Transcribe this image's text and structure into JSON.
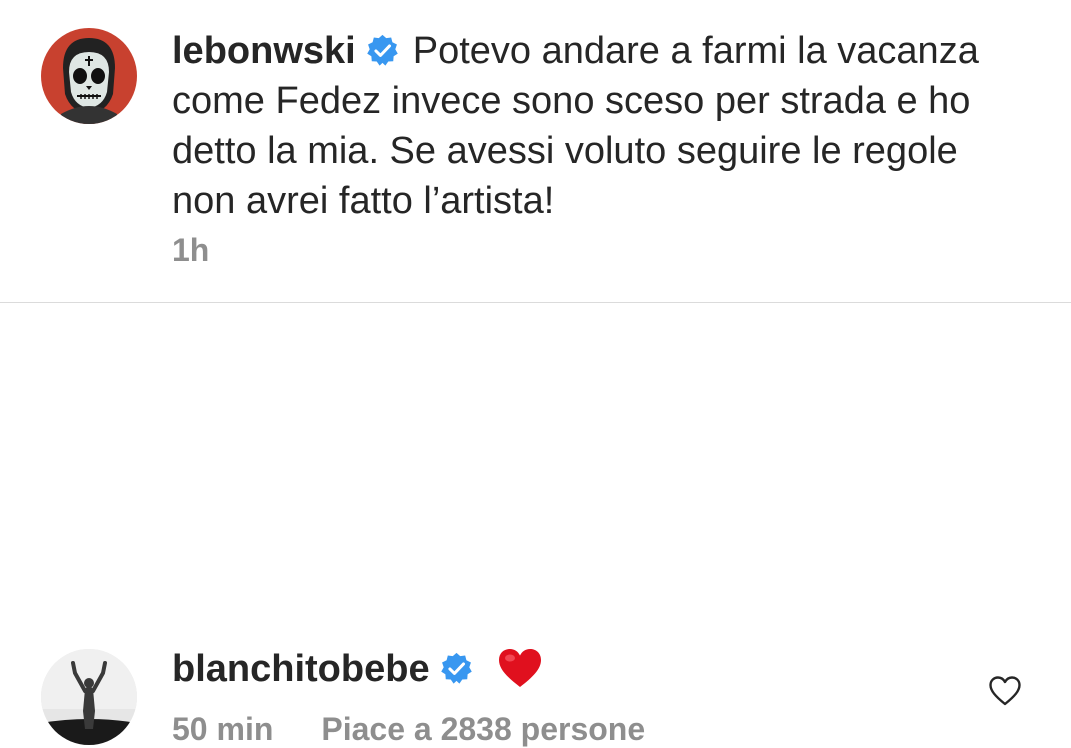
{
  "comments": [
    {
      "username": "lebonwski",
      "verified": true,
      "text": "Potevo andare a farmi la vacanza come Fedez invece sono sceso per strada e ho detto la mia. Se avessi voluto seguire le regole non avrei fatto l’artista!",
      "time": "1h",
      "avatar_icon": "skull-portrait-avatar"
    },
    {
      "username": "blanchitobebe",
      "verified": true,
      "emoji": "red-heart-emoji",
      "time": "50 min",
      "likes": "Piace a 2838 persone",
      "avatar_icon": "silhouette-avatar",
      "like_icon": "heart-outline-icon"
    }
  ],
  "colors": {
    "text": "#262626",
    "meta": "#8e8e8e",
    "verified_blue": "#3897f0",
    "divider": "#dbdbdb",
    "avatar1_bg": "#c8412f",
    "heart_red": "#e0101e"
  }
}
